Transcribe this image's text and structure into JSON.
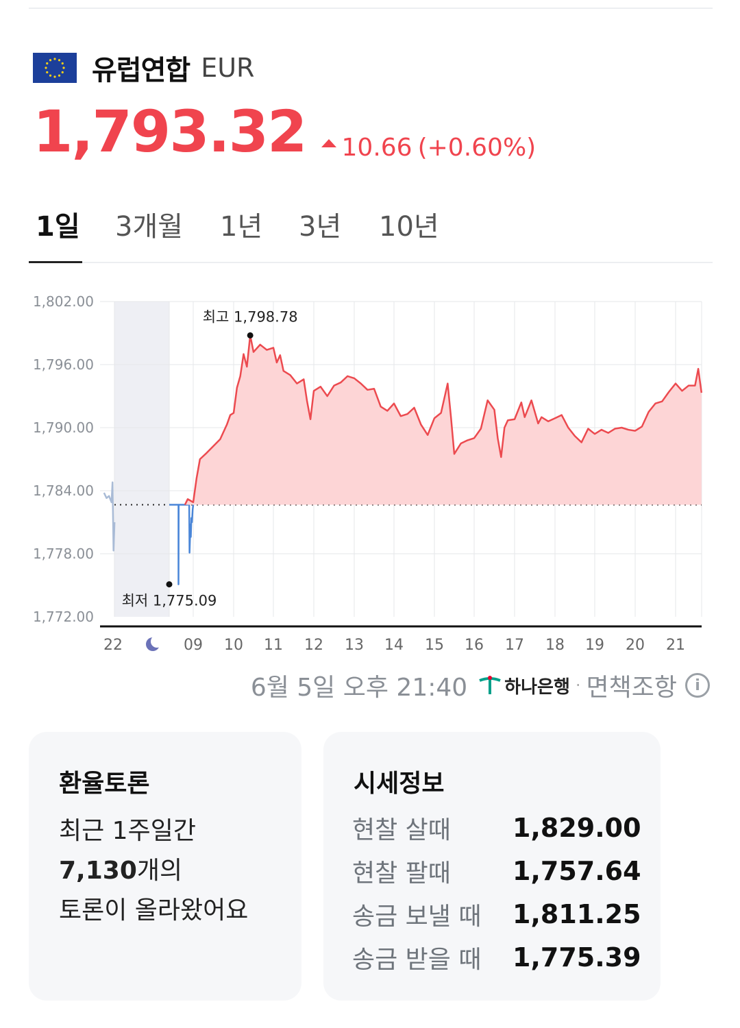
{
  "currency": {
    "name": "유럽연합",
    "code": "EUR",
    "price": "1,793.32",
    "change": "10.66",
    "change_pct": "(+0.60%)",
    "color": "#f0444e",
    "flag_icon": "eu-flag-icon"
  },
  "tabs": [
    {
      "label": "1일",
      "active": true
    },
    {
      "label": "3개월",
      "active": false
    },
    {
      "label": "1년",
      "active": false
    },
    {
      "label": "3년",
      "active": false
    },
    {
      "label": "10년",
      "active": false
    }
  ],
  "chart_data": {
    "type": "line",
    "ylim": [
      1772,
      1802
    ],
    "y_ticks": [
      "1,802.00",
      "1,796.00",
      "1,790.00",
      "1,784.00",
      "1,778.00",
      "1,772.00"
    ],
    "x_ticks": [
      "22",
      "night",
      "09",
      "10",
      "11",
      "12",
      "13",
      "14",
      "15",
      "16",
      "17",
      "18",
      "19",
      "20",
      "21"
    ],
    "night_icon": "moon-icon",
    "baseline": 1782.66,
    "high": {
      "label": "최고 1,798.78",
      "value": 1798.78,
      "time": "10:25"
    },
    "low": {
      "label": "최저 1,775.09",
      "value": 1775.09,
      "time": "07:40"
    },
    "series": [
      {
        "segment": "previous-day",
        "color": "#a9bbd6",
        "points": [
          [
            "21:50",
            1783.8
          ],
          [
            "21:55",
            1783.3
          ],
          [
            "22:00",
            1783.5
          ],
          [
            "22:05",
            1782.9
          ],
          [
            "22:07",
            1784.8
          ],
          [
            "22:09",
            1778.3
          ],
          [
            "22:11",
            1781.0
          ]
        ]
      },
      {
        "segment": "below-baseline",
        "color": "#4a86d8",
        "points": [
          [
            "06:50",
            1782.66
          ],
          [
            "07:00",
            1782.66
          ],
          [
            "07:30",
            1782.66
          ],
          [
            "07:40",
            1782.66
          ],
          [
            "07:40",
            1775.09
          ],
          [
            "07:41",
            1782.66
          ],
          [
            "08:30",
            1782.66
          ],
          [
            "08:38",
            1782.9
          ],
          [
            "08:40",
            1778.1
          ],
          [
            "08:45",
            1780.8
          ],
          [
            "08:47",
            1779.6
          ],
          [
            "08:50",
            1781.4
          ],
          [
            "08:53",
            1781.0
          ],
          [
            "08:57",
            1782.2
          ],
          [
            "09:00",
            1782.66
          ]
        ]
      },
      {
        "segment": "above-baseline",
        "color": "#ec4a4f",
        "points": [
          [
            "08:15",
            1782.66
          ],
          [
            "08:30",
            1783.2
          ],
          [
            "09:00",
            1782.9
          ],
          [
            "09:05",
            1785.2
          ],
          [
            "09:10",
            1787.0
          ],
          [
            "09:20",
            1787.6
          ],
          [
            "09:40",
            1788.9
          ],
          [
            "09:50",
            1790.3
          ],
          [
            "09:55",
            1791.2
          ],
          [
            "10:00",
            1791.4
          ],
          [
            "10:05",
            1793.8
          ],
          [
            "10:10",
            1794.9
          ],
          [
            "10:15",
            1797.0
          ],
          [
            "10:20",
            1795.8
          ],
          [
            "10:25",
            1798.78
          ],
          [
            "10:30",
            1797.2
          ],
          [
            "10:40",
            1797.9
          ],
          [
            "10:50",
            1797.4
          ],
          [
            "11:00",
            1797.6
          ],
          [
            "11:05",
            1796.2
          ],
          [
            "11:10",
            1796.9
          ],
          [
            "11:15",
            1795.4
          ],
          [
            "11:25",
            1795.0
          ],
          [
            "11:35",
            1794.2
          ],
          [
            "11:45",
            1794.6
          ],
          [
            "11:50",
            1792.5
          ],
          [
            "11:55",
            1790.8
          ],
          [
            "12:00",
            1793.5
          ],
          [
            "12:10",
            1793.9
          ],
          [
            "12:20",
            1793.0
          ],
          [
            "12:30",
            1794.0
          ],
          [
            "12:40",
            1794.3
          ],
          [
            "12:50",
            1794.9
          ],
          [
            "13:00",
            1794.7
          ],
          [
            "13:10",
            1794.2
          ],
          [
            "13:20",
            1793.6
          ],
          [
            "13:30",
            1793.7
          ],
          [
            "13:40",
            1792.0
          ],
          [
            "13:50",
            1791.6
          ],
          [
            "14:00",
            1792.3
          ],
          [
            "14:10",
            1791.1
          ],
          [
            "14:20",
            1791.3
          ],
          [
            "14:30",
            1791.9
          ],
          [
            "14:40",
            1790.3
          ],
          [
            "14:50",
            1789.3
          ],
          [
            "15:00",
            1790.9
          ],
          [
            "15:10",
            1791.4
          ],
          [
            "15:20",
            1794.2
          ],
          [
            "15:25",
            1791.0
          ],
          [
            "15:30",
            1787.5
          ],
          [
            "15:40",
            1788.5
          ],
          [
            "15:50",
            1788.8
          ],
          [
            "16:00",
            1789.0
          ],
          [
            "16:10",
            1789.9
          ],
          [
            "16:20",
            1792.6
          ],
          [
            "16:30",
            1791.7
          ],
          [
            "16:35",
            1789.0
          ],
          [
            "16:40",
            1787.2
          ],
          [
            "16:45",
            1790.0
          ],
          [
            "16:50",
            1790.7
          ],
          [
            "17:00",
            1790.8
          ],
          [
            "17:10",
            1792.4
          ],
          [
            "17:15",
            1791.0
          ],
          [
            "17:25",
            1792.6
          ],
          [
            "17:35",
            1790.4
          ],
          [
            "17:40",
            1791.0
          ],
          [
            "17:50",
            1790.6
          ],
          [
            "18:00",
            1790.9
          ],
          [
            "18:10",
            1791.2
          ],
          [
            "18:20",
            1790.0
          ],
          [
            "18:30",
            1789.2
          ],
          [
            "18:40",
            1788.6
          ],
          [
            "18:50",
            1789.9
          ],
          [
            "19:00",
            1789.4
          ],
          [
            "19:10",
            1789.8
          ],
          [
            "19:20",
            1789.5
          ],
          [
            "19:30",
            1789.9
          ],
          [
            "19:40",
            1790.0
          ],
          [
            "19:50",
            1789.8
          ],
          [
            "20:00",
            1789.7
          ],
          [
            "20:10",
            1790.1
          ],
          [
            "20:20",
            1791.5
          ],
          [
            "20:30",
            1792.3
          ],
          [
            "20:40",
            1792.5
          ],
          [
            "20:50",
            1793.4
          ],
          [
            "21:00",
            1794.2
          ],
          [
            "21:10",
            1793.5
          ],
          [
            "21:20",
            1794.0
          ],
          [
            "21:30",
            1794.0
          ],
          [
            "21:35",
            1795.6
          ],
          [
            "21:40",
            1793.32
          ]
        ]
      }
    ]
  },
  "footer": {
    "timestamp": "6월 5일 오후 21:40",
    "bank_name": "하나은행",
    "bank_icon": "hana-bank-logo-icon",
    "separator": "·",
    "disclaimer": "면책조항",
    "info_icon": "info-icon",
    "info_glyph": "i"
  },
  "debate_card": {
    "title": "환율토론",
    "line1": "최근 1주일간",
    "count": "7,130",
    "count_suffix": "개의",
    "line3": "토론이 올라왔어요"
  },
  "quote_card": {
    "title": "시세정보",
    "rows": [
      {
        "label": "현찰 살때",
        "value": "1,829.00"
      },
      {
        "label": "현찰 팔때",
        "value": "1,757.64"
      },
      {
        "label": "송금 보낼 때",
        "value": "1,811.25"
      },
      {
        "label": "송금 받을 때",
        "value": "1,775.39"
      }
    ]
  }
}
